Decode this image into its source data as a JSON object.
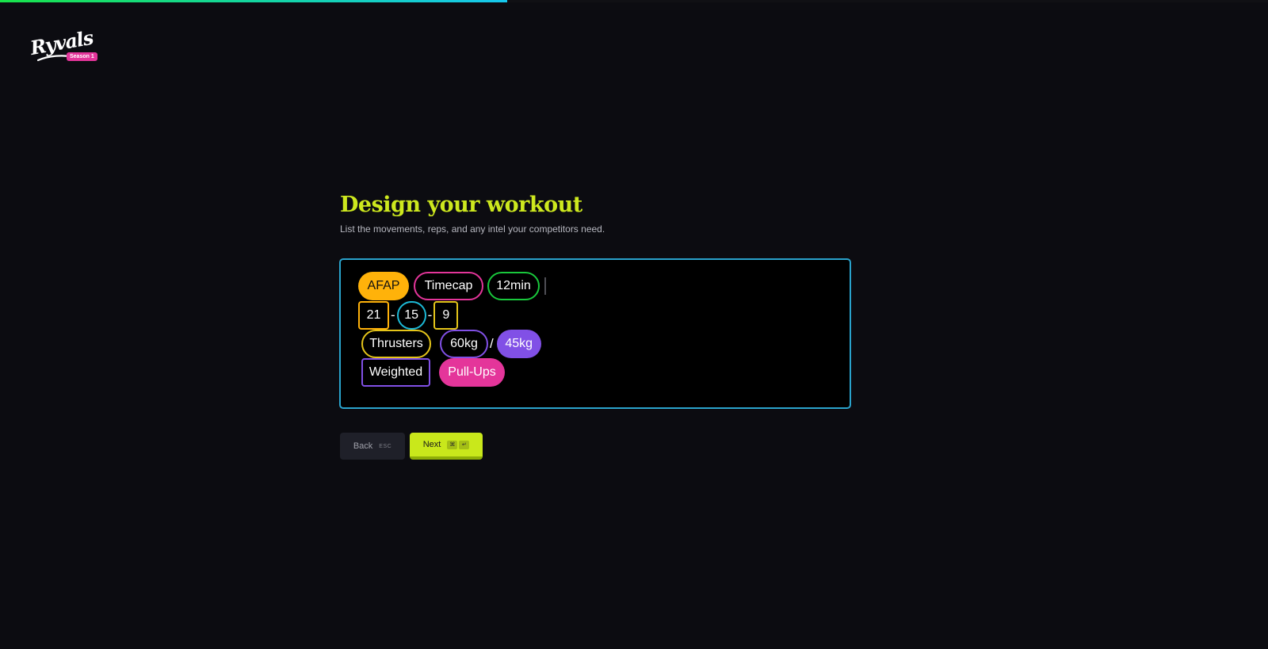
{
  "progress": {
    "fraction": 0.4
  },
  "brand": {
    "name": "Ryvals",
    "badge": "Season 1",
    "badge_color": "#e4359a"
  },
  "header": {
    "title": "Design your workout",
    "subtitle": "List the movements, reps, and any intel your competitors need."
  },
  "editor": {
    "border_color": "#2aa3cc",
    "rows": [
      [
        {
          "type": "token",
          "text": "AFAP",
          "style": "filled",
          "color": "#ffb20a",
          "text_color": "#111111",
          "shape": "pill"
        },
        {
          "type": "token",
          "text": "Timecap",
          "style": "outline",
          "color": "#e4359a",
          "shape": "pill"
        },
        {
          "type": "token",
          "text": "12min",
          "style": "outline",
          "color": "#19c83c",
          "shape": "pill"
        },
        {
          "type": "caret"
        }
      ],
      [
        {
          "type": "token",
          "text": "21",
          "style": "outline",
          "color": "#ffb20a",
          "shape": "square"
        },
        {
          "type": "sep",
          "text": "-"
        },
        {
          "type": "token",
          "text": "15",
          "style": "outline",
          "color": "#1cb9d6",
          "shape": "pill"
        },
        {
          "type": "sep",
          "text": "-"
        },
        {
          "type": "token",
          "text": "9",
          "style": "outline",
          "color": "#e5c51a",
          "shape": "square"
        }
      ],
      [
        {
          "type": "token",
          "text": "Thrusters",
          "style": "outline",
          "color": "#e5c51a",
          "shape": "pill"
        },
        {
          "type": "gap"
        },
        {
          "type": "token",
          "text": "60kg",
          "style": "outline",
          "color": "#8150e6",
          "shape": "pill"
        },
        {
          "type": "sep",
          "text": "/"
        },
        {
          "type": "token",
          "text": "45kg",
          "style": "filled",
          "color": "#8150e6",
          "text_color": "#ffffff",
          "shape": "pill"
        }
      ],
      [
        {
          "type": "token",
          "text": "Weighted",
          "style": "outline",
          "color": "#8150e6",
          "shape": "square"
        },
        {
          "type": "gap"
        },
        {
          "type": "token",
          "text": "Pull-Ups",
          "style": "filled",
          "color": "#e4359a",
          "text_color": "#ffffff",
          "shape": "pill"
        }
      ]
    ]
  },
  "actions": {
    "back_label": "Back",
    "back_shortcut": "ESC",
    "next_label": "Next",
    "next_shortcut": [
      "⌘",
      "↵"
    ],
    "next_color": "#c9e81b"
  }
}
